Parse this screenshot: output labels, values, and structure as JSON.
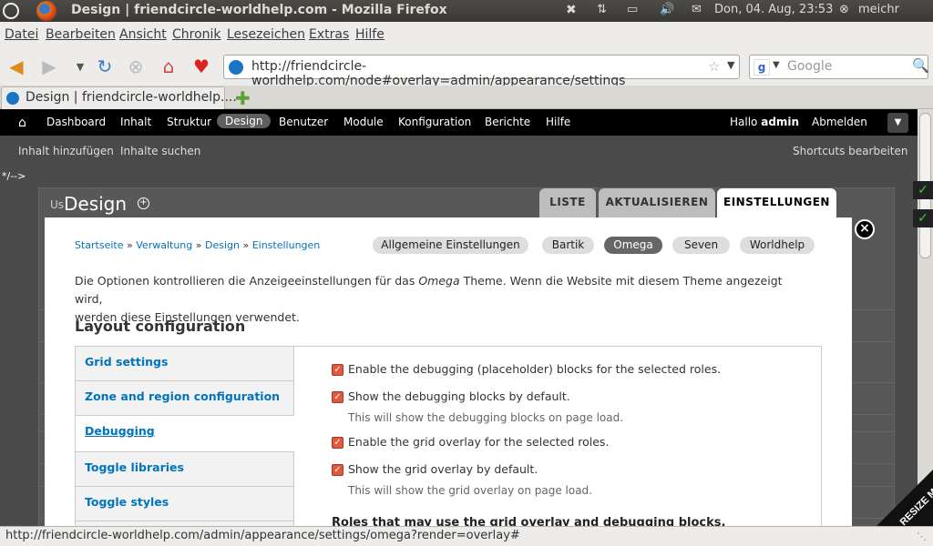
{
  "os": {
    "window_title": "Design | friendcircle-worldhelp.com - Mozilla Firefox",
    "clock": "Don, 04. Aug, 23:53",
    "user": "meichr"
  },
  "menubar": {
    "items": [
      "Datei",
      "Bearbeiten",
      "Ansicht",
      "Chronik",
      "Lesezeichen",
      "Extras",
      "Hilfe"
    ]
  },
  "navbar": {
    "url": "http://friendcircle-worldhelp.com/node#overlay=admin/appearance/settings",
    "search_placeholder": "Google"
  },
  "tabs": [
    {
      "label": "Design | friendcircle-worldhelp...."
    }
  ],
  "drupal_toolbar": {
    "items": [
      "Dashboard",
      "Inhalt",
      "Struktur",
      "Design",
      "Benutzer",
      "Module",
      "Konfiguration",
      "Berichte",
      "Hilfe"
    ],
    "active": "Design",
    "hello_prefix": "Hallo",
    "username": "admin",
    "logout": "Abmelden"
  },
  "shortcuts": {
    "add_content": "Inhalt hinzufügen",
    "find_content": "Inhalte suchen",
    "edit_shortcuts": "Shortcuts bearbeiten"
  },
  "stray_comment": "*/-->",
  "overlay": {
    "title": "Design",
    "behind_text": "Us",
    "tabs": [
      "LISTE",
      "AKTUALISIEREN",
      "EINSTELLUNGEN"
    ],
    "active_tab": "EINSTELLUNGEN",
    "breadcrumb": [
      "Startseite",
      "Verwaltung",
      "Design",
      "Einstellungen"
    ],
    "breadcrumb_sep": "»",
    "theme_pills": [
      "Allgemeine Einstellungen",
      "Bartik",
      "Omega",
      "Seven",
      "Worldhelp"
    ],
    "active_pill": "Omega",
    "intro_before": "Die Optionen kontrollieren die Anzeigeeinstellungen für das",
    "intro_theme": "Omega",
    "intro_after": "Theme. Wenn die Website mit diesem Theme angezeigt wird,",
    "intro_line2": "werden diese Einstellungen verwendet.",
    "section_heading": "Layout configuration",
    "vertical_tabs": [
      "Grid settings",
      "Zone and region configuration",
      "Debugging",
      "Toggle libraries",
      "Toggle styles"
    ],
    "active_vertical_tab": "Debugging",
    "options": [
      {
        "label": "Enable the debugging (placeholder) blocks for the selected roles.",
        "checked": true
      },
      {
        "label": "Show the debugging blocks by default.",
        "checked": true,
        "description": "This will show the debugging blocks on page load."
      },
      {
        "label": "Enable the grid overlay for the selected roles.",
        "checked": true
      },
      {
        "label": "Show the grid overlay by default.",
        "checked": true,
        "description": "This will show the grid overlay on page load."
      }
    ],
    "roles_heading": "Roles that may use the grid overlay and debugging blocks."
  },
  "resize_label": "RESIZE ME",
  "statusbar": {
    "text": "http://friendcircle-worldhelp.com/admin/appearance/settings/omega?render=overlay#"
  }
}
